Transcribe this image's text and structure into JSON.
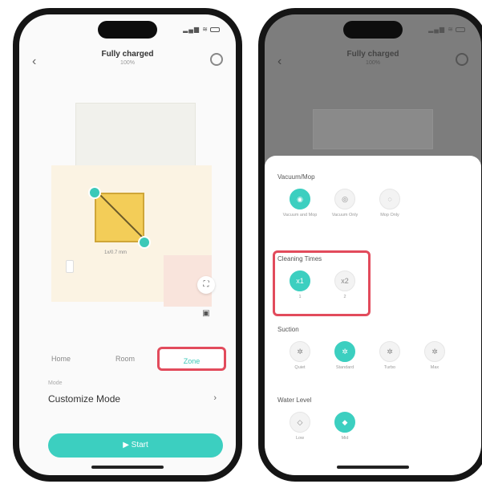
{
  "left_phone": {
    "title": "Fully charged",
    "subtitle": "100%",
    "back_icon": "chevron-left-icon",
    "settings_icon": "gear-icon",
    "map": {
      "zone_label": "1x/0.7 mm",
      "tools": [
        "scan-icon",
        "map-icon"
      ]
    },
    "tabs": [
      {
        "label": "Home",
        "active": false
      },
      {
        "label": "Room",
        "active": false
      },
      {
        "label": "Zone",
        "active": true
      }
    ],
    "mode_caption": "Mode",
    "mode_value": "Customize Mode",
    "start_label": "Start"
  },
  "right_phone": {
    "title": "Fully charged",
    "subtitle": "100%",
    "sheet": {
      "vacuum_title": "Vacuum/Mop",
      "vacuum_options": [
        {
          "label": "Vacuum and Mop",
          "selected": true
        },
        {
          "label": "Vacuum Only",
          "selected": false
        },
        {
          "label": "Mop Only",
          "selected": false
        }
      ],
      "cleaning_title": "Cleaning Times",
      "cleaning_options": [
        {
          "value": "x1",
          "label": "1",
          "selected": true
        },
        {
          "value": "x2",
          "label": "2",
          "selected": false
        }
      ],
      "suction_title": "Suction",
      "suction_options": [
        {
          "label": "Quiet",
          "selected": false
        },
        {
          "label": "Standard",
          "selected": true
        },
        {
          "label": "Turbo",
          "selected": false
        },
        {
          "label": "Max",
          "selected": false
        }
      ],
      "water_title": "Water Level",
      "water_options": [
        {
          "label": "Low",
          "selected": false
        },
        {
          "label": "Mid",
          "selected": true
        }
      ]
    }
  },
  "colors": {
    "accent": "#3ccfc0",
    "highlight": "#e24b5c",
    "zone": "#f3cd58"
  }
}
